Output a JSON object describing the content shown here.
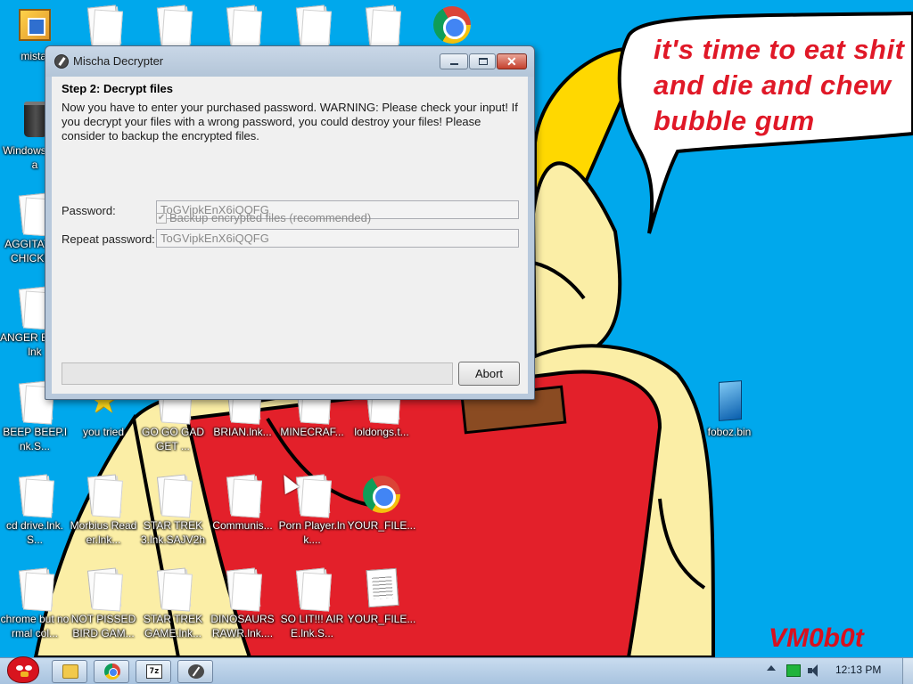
{
  "wallpaper": {
    "caption": "it's time to eat shit and die and chew bubble gum",
    "signature": "VM0b0t",
    "colors": {
      "sky": "#00a8ec",
      "skin": "#fbeea6",
      "shirt": "#e3202a",
      "hat": "#ffd800"
    }
  },
  "desktop": {
    "icons": [
      {
        "label": "mistal",
        "icon": "setup-icon"
      },
      {
        "label": "",
        "icon": "document-icon"
      },
      {
        "label": "",
        "icon": "document-icon"
      },
      {
        "label": "",
        "icon": "document-icon"
      },
      {
        "label": "",
        "icon": "document-icon"
      },
      {
        "label": "",
        "icon": "document-icon"
      },
      {
        "label": "",
        "icon": "chrome-icon"
      },
      {
        "label": "Windows Vista",
        "icon": "recycle-bin-icon"
      },
      {
        "label": "AGGITATED CHICKEN",
        "icon": "document-icon"
      },
      {
        "label": "ANGER BIRD.lnk",
        "icon": "document-icon"
      },
      {
        "label": "BEEP BEEP.lnk.S...",
        "icon": "document-icon"
      },
      {
        "label": "you tried",
        "icon": "star-icon"
      },
      {
        "label": "GO GO GADGET ...",
        "icon": "document-icon"
      },
      {
        "label": "BRIAN.lnk...",
        "icon": "document-icon"
      },
      {
        "label": "MINECRAF...",
        "icon": "document-icon"
      },
      {
        "label": "loldongs.t...",
        "icon": "document-icon"
      },
      {
        "label": "foboz.bin",
        "icon": "bin-file-icon"
      },
      {
        "label": "cd drive.lnk.S...",
        "icon": "document-icon"
      },
      {
        "label": "Morbius Reader.lnk...",
        "icon": "document-icon"
      },
      {
        "label": "STAR TREK 3.lnk.SAJV2h",
        "icon": "document-icon"
      },
      {
        "label": "Communis...",
        "icon": "document-icon"
      },
      {
        "label": "Porn Player.lnk....",
        "icon": "document-icon"
      },
      {
        "label": "YOUR_FILE...",
        "icon": "chrome-icon"
      },
      {
        "label": "chrome but normal col...",
        "icon": "document-icon"
      },
      {
        "label": "NOT PISSED BIRD GAM...",
        "icon": "document-icon"
      },
      {
        "label": "STAR TREK GAME.lnk...",
        "icon": "document-icon"
      },
      {
        "label": "DINOSAURS RAWR.lnk....",
        "icon": "document-icon"
      },
      {
        "label": "SO LIT!!! AIRE.lnk.S...",
        "icon": "document-icon"
      },
      {
        "label": "YOUR_FILE...",
        "icon": "text-file-icon"
      }
    ]
  },
  "dialog": {
    "title": "Mischa Decrypter",
    "step_heading": "Step 2: Decrypt files",
    "warning": "Now you have to enter your purchased password. WARNING: Please check your input! If you decrypt your files with a wrong password, you could destroy your files! Please consider to backup the encrypted files.",
    "password_label": "Password:",
    "password_value": "ToGVipkEnX6iQQFG",
    "repeat_label": "Repeat password:",
    "repeat_value": "ToGVipkEnX6iQQFG",
    "backup_label": "Backup encrypted files (recommended)",
    "backup_checked": true,
    "progress": 0,
    "abort_label": "Abort",
    "window_buttons": {
      "minimize": "minimize-icon",
      "maximize": "maximize-icon",
      "close": "close-icon"
    }
  },
  "taskbar": {
    "start_icon": "angry-bird-start-icon",
    "apps": [
      {
        "name": "explorer-icon"
      },
      {
        "name": "chrome-icon"
      },
      {
        "name": "7zip-icon",
        "glyph": "7z"
      },
      {
        "name": "mischa-decrypter-icon"
      }
    ],
    "clock": "12:13 PM"
  }
}
